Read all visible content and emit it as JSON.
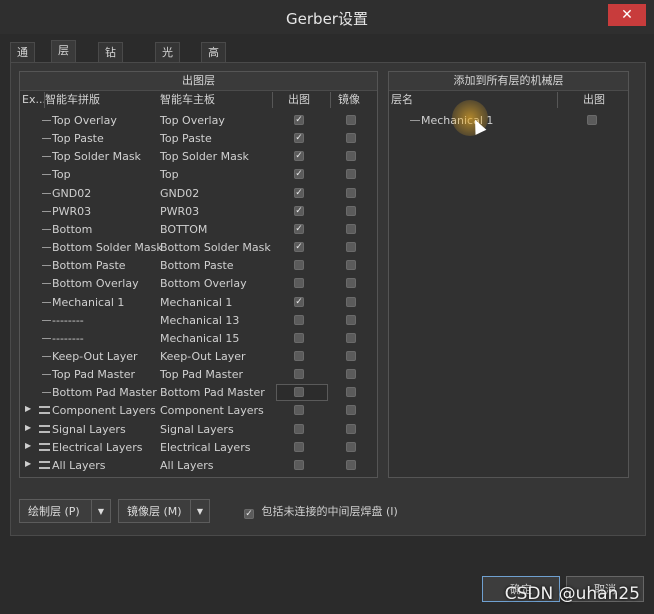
{
  "window": {
    "title": "Gerber设置",
    "close_icon": "close-icon"
  },
  "tabs": [
    {
      "label": "通用",
      "active": false
    },
    {
      "label": "层",
      "active": true
    },
    {
      "label": "钻孔图层",
      "active": false
    },
    {
      "label": "光圈",
      "active": false
    },
    {
      "label": "高级",
      "active": false
    }
  ],
  "plot_layers": {
    "header": "出图层",
    "columns": {
      "ex": "Ex...",
      "panel_name": "智能车拼版",
      "board_name": "智能车主板",
      "plot": "出图",
      "mirror": "镜像"
    },
    "rows": [
      {
        "name": "Top Overlay",
        "board": "Top Overlay",
        "plot": true,
        "mirror": false,
        "group": false
      },
      {
        "name": "Top Paste",
        "board": "Top Paste",
        "plot": true,
        "mirror": false,
        "group": false
      },
      {
        "name": "Top Solder Mask",
        "board": "Top Solder Mask",
        "plot": true,
        "mirror": false,
        "group": false
      },
      {
        "name": "Top",
        "board": "Top",
        "plot": true,
        "mirror": false,
        "group": false
      },
      {
        "name": "GND02",
        "board": "GND02",
        "plot": true,
        "mirror": false,
        "group": false
      },
      {
        "name": "PWR03",
        "board": "PWR03",
        "plot": true,
        "mirror": false,
        "group": false
      },
      {
        "name": "Bottom",
        "board": "BOTTOM",
        "plot": true,
        "mirror": false,
        "group": false
      },
      {
        "name": "Bottom Solder Mask",
        "board": "Bottom Solder Mask",
        "plot": true,
        "mirror": false,
        "group": false
      },
      {
        "name": "Bottom Paste",
        "board": "Bottom Paste",
        "plot": false,
        "mirror": false,
        "group": false
      },
      {
        "name": "Bottom Overlay",
        "board": "Bottom Overlay",
        "plot": false,
        "mirror": false,
        "group": false
      },
      {
        "name": "Mechanical 1",
        "board": "Mechanical 1",
        "plot": true,
        "mirror": false,
        "group": false
      },
      {
        "name": "--------",
        "board": "Mechanical 13",
        "plot": false,
        "mirror": false,
        "group": false
      },
      {
        "name": "--------",
        "board": "Mechanical 15",
        "plot": false,
        "mirror": false,
        "group": false
      },
      {
        "name": "Keep-Out Layer",
        "board": "Keep-Out Layer",
        "plot": false,
        "mirror": false,
        "group": false
      },
      {
        "name": "Top Pad Master",
        "board": "Top Pad Master",
        "plot": false,
        "mirror": false,
        "group": false
      },
      {
        "name": "Bottom Pad Master",
        "board": "Bottom Pad Master",
        "plot": false,
        "mirror": false,
        "group": false
      },
      {
        "name": "Component Layers",
        "board": "Component Layers",
        "plot": false,
        "mirror": false,
        "group": true
      },
      {
        "name": "Signal Layers",
        "board": "Signal Layers",
        "plot": false,
        "mirror": false,
        "group": true
      },
      {
        "name": "Electrical Layers",
        "board": "Electrical Layers",
        "plot": false,
        "mirror": false,
        "group": true
      },
      {
        "name": "All Layers",
        "board": "All Layers",
        "plot": false,
        "mirror": false,
        "group": true
      }
    ]
  },
  "mech_layers": {
    "header": "添加到所有层的机械层",
    "columns": {
      "name": "层名",
      "plot": "出图"
    },
    "rows": [
      {
        "name": "Mechanical 1",
        "plot": false
      }
    ]
  },
  "controls": {
    "plot_layers_btn": "绘制层 (P)",
    "mirror_layers_btn": "镜像层 (M)",
    "include_unconnected": "包括未连接的中间层焊盘 (I)",
    "include_unconnected_checked": true
  },
  "footer": {
    "ok": "确定",
    "cancel": "取消"
  },
  "watermark": "CSDN @uhan25"
}
